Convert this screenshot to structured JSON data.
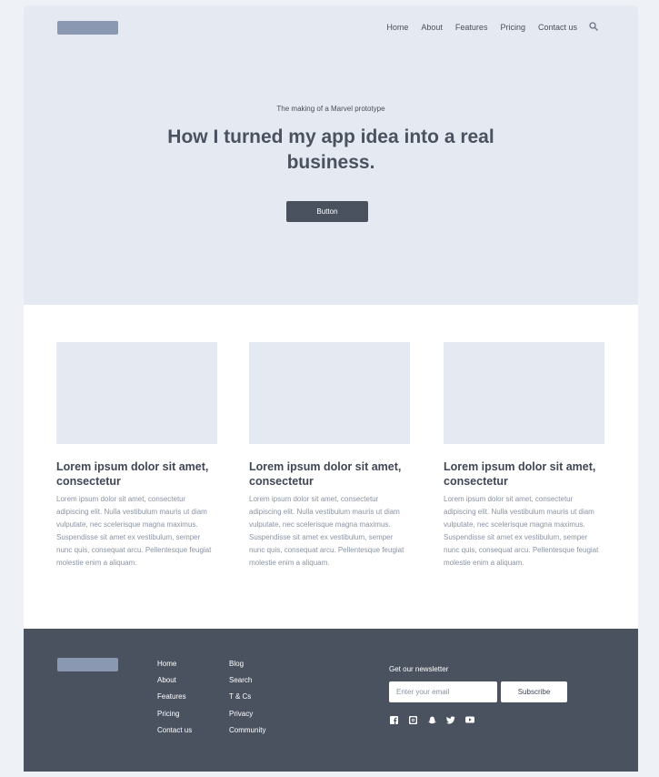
{
  "nav": {
    "items": [
      "Home",
      "About",
      "Features",
      "Pricing",
      "Contact us"
    ],
    "search_icon": "search-icon"
  },
  "hero": {
    "eyebrow": "The making of a Marvel prototype",
    "headline": "How I turned my app idea into a real business.",
    "button_label": "Button"
  },
  "cards": [
    {
      "title": "Lorem ipsum dolor sit amet, consectetur",
      "body": "Lorem ipsum dolor sit amet, consectetur adipiscing elit. Nulla vestibulum mauris ut diam vulputate, nec scelerisque magna maximus. Suspendisse sit amet ex vestibulum, semper nunc quis, consequat arcu. Pellentesque feugiat molestie enim a aliquam."
    },
    {
      "title": "Lorem ipsum dolor sit amet, consectetur",
      "body": "Lorem ipsum dolor sit amet, consectetur adipiscing elit. Nulla vestibulum mauris ut diam vulputate, nec scelerisque magna maximus. Suspendisse sit amet ex vestibulum, semper nunc quis, consequat arcu. Pellentesque feugiat molestie enim a aliquam."
    },
    {
      "title": "Lorem ipsum dolor sit amet, consectetur",
      "body": "Lorem ipsum dolor sit amet, consectetur adipiscing elit. Nulla vestibulum mauris ut diam vulputate, nec scelerisque magna maximus. Suspendisse sit amet ex vestibulum, semper nunc quis, consequat arcu. Pellentesque feugiat molestie enim a aliquam."
    }
  ],
  "footer": {
    "links_col1": [
      "Home",
      "About",
      "Features",
      "Pricing",
      "Contact us"
    ],
    "links_col2": [
      "Blog",
      "Search",
      "T & Cs",
      "Privacy",
      "Community"
    ],
    "newsletter_title": "Get our newsletter",
    "email_placeholder": "Enter your email",
    "subscribe_label": "Subscribe",
    "social_icons": [
      "facebook-icon",
      "instagram-icon",
      "snapchat-icon",
      "twitter-icon",
      "youtube-icon"
    ]
  },
  "colors": {
    "background": "#eef2f7",
    "hero_bg": "#e5e9f1",
    "dark": "#4a5260",
    "logo_placeholder": "#8a98b1",
    "body_text": "#8a93a3"
  }
}
